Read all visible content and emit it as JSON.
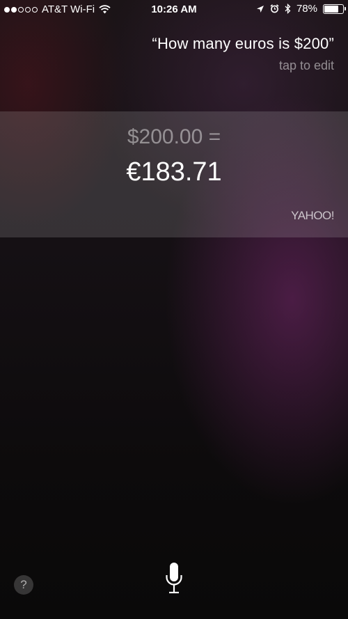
{
  "status_bar": {
    "carrier": "AT&T Wi-Fi",
    "time": "10:26 AM",
    "battery_percent": "78%",
    "battery_level": 0.78,
    "signal_bars_filled": 2,
    "signal_bars_total": 5,
    "icons": [
      "wifi-icon",
      "location-icon",
      "alarm-icon",
      "bluetooth-icon",
      "battery-icon"
    ]
  },
  "query": {
    "text": "“How many euros is $200”",
    "edit_hint": "tap to edit"
  },
  "answer": {
    "from_amount": "$200.00 =",
    "to_amount": "€183.71",
    "source": "YAHOO!"
  },
  "controls": {
    "help_label": "?",
    "mic_icon": "microphone-icon"
  }
}
